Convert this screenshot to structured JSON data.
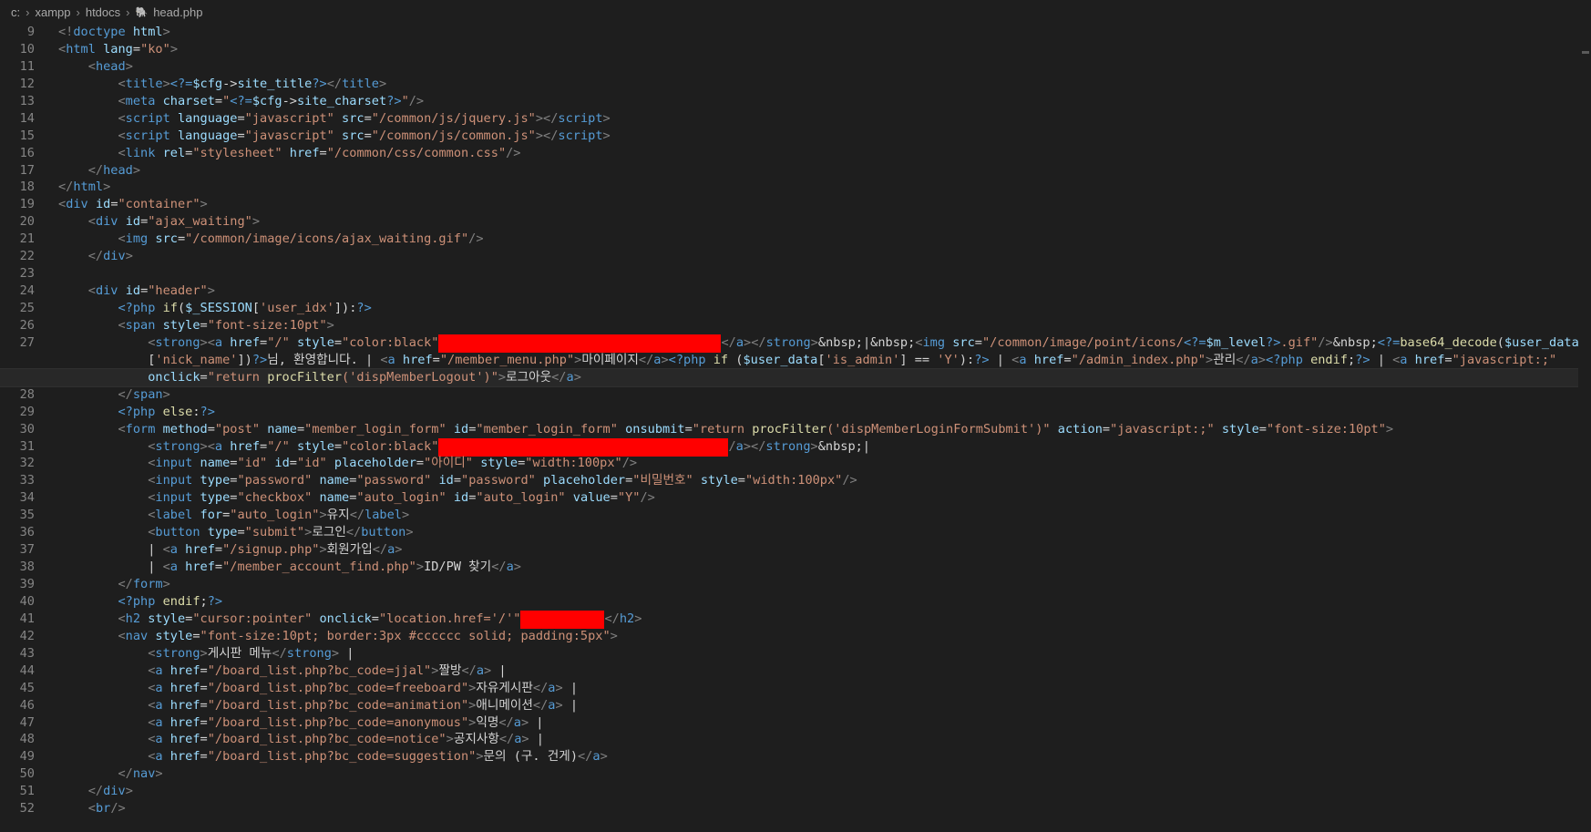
{
  "breadcrumb": {
    "parts": [
      "c:",
      "xampp",
      "htdocs"
    ],
    "file_icon": "php-icon",
    "file": "head.php"
  },
  "lines": [
    {
      "n": "9",
      "html": "<span class='t'>&lt;!</span><span class='tag'>doctype</span> <span class='at'>html</span><span class='t'>&gt;</span>"
    },
    {
      "n": "10",
      "html": "<span class='t'>&lt;</span><span class='tag'>html</span> <span class='at'>lang</span>=<span class='v'>\"ko\"</span><span class='t'>&gt;</span>"
    },
    {
      "n": "11",
      "html": "    <span class='t'>&lt;</span><span class='tag'>head</span><span class='t'>&gt;</span>"
    },
    {
      "n": "12",
      "html": "        <span class='t'>&lt;</span><span class='tag'>title</span><span class='t'>&gt;</span><span class='php'>&lt;?=</span><span class='var'>$cfg</span>-&gt;<span class='var'>site_title</span><span class='php'>?&gt;</span><span class='t'>&lt;/</span><span class='tag'>title</span><span class='t'>&gt;</span>"
    },
    {
      "n": "13",
      "html": "        <span class='t'>&lt;</span><span class='tag'>meta</span> <span class='at'>charset</span>=<span class='v'>\"</span><span class='php'>&lt;?=</span><span class='var'>$cfg</span>-&gt;<span class='var'>site_charset</span><span class='php'>?&gt;</span><span class='v'>\"</span><span class='t'>/&gt;</span>"
    },
    {
      "n": "14",
      "html": "        <span class='t'>&lt;</span><span class='tag'>script</span> <span class='at'>language</span>=<span class='v'>\"javascript\"</span> <span class='at'>src</span>=<span class='v'>\"/common/js/jquery.js\"</span><span class='t'>&gt;&lt;/</span><span class='tag'>script</span><span class='t'>&gt;</span>"
    },
    {
      "n": "15",
      "html": "        <span class='t'>&lt;</span><span class='tag'>script</span> <span class='at'>language</span>=<span class='v'>\"javascript\"</span> <span class='at'>src</span>=<span class='v'>\"/common/js/common.js\"</span><span class='t'>&gt;&lt;/</span><span class='tag'>script</span><span class='t'>&gt;</span>"
    },
    {
      "n": "16",
      "html": "        <span class='t'>&lt;</span><span class='tag'>link</span> <span class='at'>rel</span>=<span class='v'>\"stylesheet\"</span> <span class='at'>href</span>=<span class='v'>\"/common/css/common.css\"</span><span class='t'>/&gt;</span>"
    },
    {
      "n": "17",
      "html": "    <span class='t'>&lt;/</span><span class='tag'>head</span><span class='t'>&gt;</span>"
    },
    {
      "n": "18",
      "html": "<span class='t'>&lt;/</span><span class='tag'>html</span><span class='t'>&gt;</span>"
    },
    {
      "n": "19",
      "html": "<span class='t'>&lt;</span><span class='tag'>div</span> <span class='at'>id</span>=<span class='v'>\"container\"</span><span class='t'>&gt;</span>"
    },
    {
      "n": "20",
      "html": "    <span class='t'>&lt;</span><span class='tag'>div</span> <span class='at'>id</span>=<span class='v'>\"ajax_waiting\"</span><span class='t'>&gt;</span>"
    },
    {
      "n": "21",
      "html": "        <span class='t'>&lt;</span><span class='tag'>img</span> <span class='at'>src</span>=<span class='v'>\"/common/image/icons/ajax_waiting.gif\"</span><span class='t'>/&gt;</span>"
    },
    {
      "n": "22",
      "html": "    <span class='t'>&lt;/</span><span class='tag'>div</span><span class='t'>&gt;</span>"
    },
    {
      "n": "23",
      "html": ""
    },
    {
      "n": "24",
      "html": "    <span class='t'>&lt;</span><span class='tag'>div</span> <span class='at'>id</span>=<span class='v'>\"header\"</span><span class='t'>&gt;</span>"
    },
    {
      "n": "25",
      "html": "        <span class='php'>&lt;?php</span> <span class='fn'>if</span>(<span class='var'>$_SESSION</span>[<span class='v'>'user_idx'</span>]):<span class='php'>?&gt;</span>"
    },
    {
      "n": "26",
      "html": "        <span class='t'>&lt;</span><span class='tag'>span</span> <span class='at'>style</span>=<span class='v'>\"font-size:10pt\"</span><span class='t'>&gt;</span>"
    },
    {
      "n": "27",
      "html": "            <span class='t'>&lt;</span><span class='tag'>strong</span><span class='t'>&gt;&lt;</span><span class='tag'>a</span> <span class='at'>href</span>=<span class='v'>\"/\"</span> <span class='at'>style</span>=<span class='v'>\"color:black\"</span><span class='redact' style='width:310px'></span><span class='t'>&lt;/</span><span class='tag'>a</span><span class='t'>&gt;&lt;/</span><span class='tag'>strong</span><span class='t'>&gt;</span>&amp;nbsp;|&amp;nbsp;<span class='t'>&lt;</span><span class='tag'>img</span> <span class='at'>src</span>=<span class='v'>\"/common/image/point/icons/</span><span class='php'>&lt;?=</span><span class='var'>$m_level</span><span class='php'>?&gt;</span><span class='v'>.gif\"</span><span class='t'>/&gt;</span>&amp;nbsp;<span class='php'>&lt;?=</span><span class='fn'>base64_decode</span>(<span class='var'>$user_data</span>"
    },
    {
      "n": "",
      "html": "            [<span class='v'>'nick_name'</span>])<span class='php'>?&gt;</span>님, 환영합니다. | <span class='t'>&lt;</span><span class='tag'>a</span> <span class='at'>href</span>=<span class='v'>\"/member_menu.php\"</span><span class='t'>&gt;</span>마이페이지<span class='t'>&lt;/</span><span class='tag'>a</span><span class='t'>&gt;</span><span class='php'>&lt;?php</span> <span class='fn'>if</span> (<span class='var'>$user_data</span>[<span class='v'>'is_admin'</span>] == <span class='v'>'Y'</span>):<span class='php'>?&gt;</span> | <span class='t'>&lt;</span><span class='tag'>a</span> <span class='at'>href</span>=<span class='v'>\"/admin_index.php\"</span><span class='t'>&gt;</span>관리<span class='t'>&lt;/</span><span class='tag'>a</span><span class='t'>&gt;</span><span class='php'>&lt;?php</span> <span class='fn'>endif</span>;<span class='php'>?&gt;</span> | <span class='t'>&lt;</span><span class='tag'>a</span> <span class='at'>href</span>=<span class='v'>\"javascript:;\"</span>"
    },
    {
      "n": "",
      "cur": true,
      "html": "            <span class='at'>onclick</span>=<span class='v'>\"return </span><span class='fn'>procFilter</span><span class='v'>('dispMemberLogout')\"</span><span class='t'>&gt;</span>로그아웃<span class='t'>&lt;/</span><span class='tag'>a</span><span class='t'>&gt;</span>"
    },
    {
      "n": "28",
      "html": "        <span class='t'>&lt;/</span><span class='tag'>span</span><span class='t'>&gt;</span>"
    },
    {
      "n": "29",
      "html": "        <span class='php'>&lt;?php</span> <span class='fn'>else</span>:<span class='php'>?&gt;</span>"
    },
    {
      "n": "30",
      "html": "        <span class='t'>&lt;</span><span class='tag'>form</span> <span class='at'>method</span>=<span class='v'>\"post\"</span> <span class='at'>name</span>=<span class='v'>\"member_login_form\"</span> <span class='at'>id</span>=<span class='v'>\"member_login_form\"</span> <span class='at'>onsubmit</span>=<span class='v'>\"return </span><span class='fn'>procFilter</span><span class='v'>('dispMemberLoginFormSubmit')\"</span> <span class='at'>action</span>=<span class='v'>\"javascript:;\"</span> <span class='at'>style</span>=<span class='v'>\"font-size:10pt\"</span><span class='t'>&gt;</span>"
    },
    {
      "n": "31",
      "html": "            <span class='t'>&lt;</span><span class='tag'>strong</span><span class='t'>&gt;&lt;</span><span class='tag'>a</span> <span class='at'>href</span>=<span class='v'>\"/\"</span> <span class='at'>style</span>=<span class='v'>\"color:black\"</span><span class='redact' style='width:318px'></span><span class='t'>/</span><span class='tag'>a</span><span class='t'>&gt;&lt;/</span><span class='tag'>strong</span><span class='t'>&gt;</span>&amp;nbsp;|"
    },
    {
      "n": "32",
      "html": "            <span class='t'>&lt;</span><span class='tag'>input</span> <span class='at'>name</span>=<span class='v'>\"id\"</span> <span class='at'>id</span>=<span class='v'>\"id\"</span> <span class='at'>placeholder</span>=<span class='v'>\"아이디\"</span> <span class='at'>style</span>=<span class='v'>\"width:100px\"</span><span class='t'>/&gt;</span>"
    },
    {
      "n": "33",
      "html": "            <span class='t'>&lt;</span><span class='tag'>input</span> <span class='at'>type</span>=<span class='v'>\"password\"</span> <span class='at'>name</span>=<span class='v'>\"password\"</span> <span class='at'>id</span>=<span class='v'>\"password\"</span> <span class='at'>placeholder</span>=<span class='v'>\"비밀번호\"</span> <span class='at'>style</span>=<span class='v'>\"width:100px\"</span><span class='t'>/&gt;</span>"
    },
    {
      "n": "34",
      "html": "            <span class='t'>&lt;</span><span class='tag'>input</span> <span class='at'>type</span>=<span class='v'>\"checkbox\"</span> <span class='at'>name</span>=<span class='v'>\"auto_login\"</span> <span class='at'>id</span>=<span class='v'>\"auto_login\"</span> <span class='at'>value</span>=<span class='v'>\"Y\"</span><span class='t'>/&gt;</span>"
    },
    {
      "n": "35",
      "html": "            <span class='t'>&lt;</span><span class='tag'>label</span> <span class='at'>for</span>=<span class='v'>\"auto_login\"</span><span class='t'>&gt;</span>유지<span class='t'>&lt;/</span><span class='tag'>label</span><span class='t'>&gt;</span>"
    },
    {
      "n": "36",
      "html": "            <span class='t'>&lt;</span><span class='tag'>button</span> <span class='at'>type</span>=<span class='v'>\"submit\"</span><span class='t'>&gt;</span>로그인<span class='t'>&lt;/</span><span class='tag'>button</span><span class='t'>&gt;</span>"
    },
    {
      "n": "37",
      "html": "            | <span class='t'>&lt;</span><span class='tag'>a</span> <span class='at'>href</span>=<span class='v'>\"/signup.php\"</span><span class='t'>&gt;</span>회원가입<span class='t'>&lt;/</span><span class='tag'>a</span><span class='t'>&gt;</span>"
    },
    {
      "n": "38",
      "html": "            | <span class='t'>&lt;</span><span class='tag'>a</span> <span class='at'>href</span>=<span class='v'>\"/member_account_find.php\"</span><span class='t'>&gt;</span>ID/PW 찾기<span class='t'>&lt;/</span><span class='tag'>a</span><span class='t'>&gt;</span>"
    },
    {
      "n": "39",
      "html": "        <span class='t'>&lt;/</span><span class='tag'>form</span><span class='t'>&gt;</span>"
    },
    {
      "n": "40",
      "html": "        <span class='php'>&lt;?php</span> <span class='fn'>endif</span>;<span class='php'>?&gt;</span>"
    },
    {
      "n": "41",
      "html": "        <span class='t'>&lt;</span><span class='tag'>h2</span> <span class='at'>style</span>=<span class='v'>\"cursor:pointer\"</span> <span class='at'>onclick</span>=<span class='v'>\"location.href='/'\"</span><span class='redact' style='width:92px'></span><span class='t'>&lt;/</span><span class='tag'>h2</span><span class='t'>&gt;</span>"
    },
    {
      "n": "42",
      "html": "        <span class='t'>&lt;</span><span class='tag'>nav</span> <span class='at'>style</span>=<span class='v'>\"font-size:10pt; border:3px #cccccc solid; padding:5px\"</span><span class='t'>&gt;</span>"
    },
    {
      "n": "43",
      "html": "            <span class='t'>&lt;</span><span class='tag'>strong</span><span class='t'>&gt;</span>게시판 메뉴<span class='t'>&lt;/</span><span class='tag'>strong</span><span class='t'>&gt;</span> |"
    },
    {
      "n": "44",
      "html": "            <span class='t'>&lt;</span><span class='tag'>a</span> <span class='at'>href</span>=<span class='v'>\"/board_list.php?bc_code=jjal\"</span><span class='t'>&gt;</span>짤방<span class='t'>&lt;/</span><span class='tag'>a</span><span class='t'>&gt;</span> |"
    },
    {
      "n": "45",
      "html": "            <span class='t'>&lt;</span><span class='tag'>a</span> <span class='at'>href</span>=<span class='v'>\"/board_list.php?bc_code=freeboard\"</span><span class='t'>&gt;</span>자유게시판<span class='t'>&lt;/</span><span class='tag'>a</span><span class='t'>&gt;</span> |"
    },
    {
      "n": "46",
      "html": "            <span class='t'>&lt;</span><span class='tag'>a</span> <span class='at'>href</span>=<span class='v'>\"/board_list.php?bc_code=animation\"</span><span class='t'>&gt;</span>애니메이션<span class='t'>&lt;/</span><span class='tag'>a</span><span class='t'>&gt;</span> |"
    },
    {
      "n": "47",
      "html": "            <span class='t'>&lt;</span><span class='tag'>a</span> <span class='at'>href</span>=<span class='v'>\"/board_list.php?bc_code=anonymous\"</span><span class='t'>&gt;</span>익명<span class='t'>&lt;/</span><span class='tag'>a</span><span class='t'>&gt;</span> |"
    },
    {
      "n": "48",
      "html": "            <span class='t'>&lt;</span><span class='tag'>a</span> <span class='at'>href</span>=<span class='v'>\"/board_list.php?bc_code=notice\"</span><span class='t'>&gt;</span>공지사항<span class='t'>&lt;/</span><span class='tag'>a</span><span class='t'>&gt;</span> |"
    },
    {
      "n": "49",
      "html": "            <span class='t'>&lt;</span><span class='tag'>a</span> <span class='at'>href</span>=<span class='v'>\"/board_list.php?bc_code=suggestion\"</span><span class='t'>&gt;</span>문의 (구. 건게)<span class='t'>&lt;/</span><span class='tag'>a</span><span class='t'>&gt;</span>"
    },
    {
      "n": "50",
      "html": "        <span class='t'>&lt;/</span><span class='tag'>nav</span><span class='t'>&gt;</span>"
    },
    {
      "n": "51",
      "html": "    <span class='t'>&lt;/</span><span class='tag'>div</span><span class='t'>&gt;</span>"
    },
    {
      "n": "52",
      "html": "    <span class='t'>&lt;</span><span class='tag'>br</span><span class='t'>/&gt;</span>"
    }
  ]
}
